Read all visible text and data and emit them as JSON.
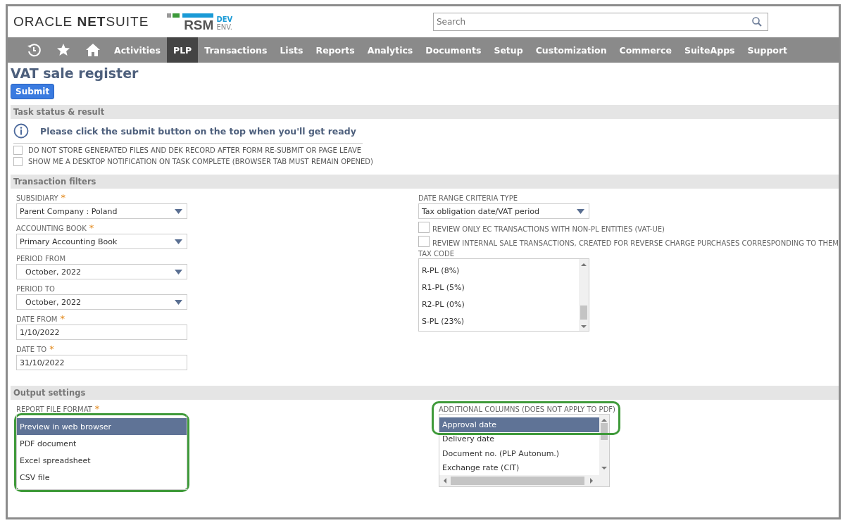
{
  "header": {
    "logo": "ORACLE **NET**SUITE",
    "rsm": "RSM",
    "env_top": "DEV",
    "env_bottom": "ENV.",
    "search": {
      "placeholder": "Search"
    }
  },
  "nav": {
    "icons": [
      {
        "kind": "recent"
      },
      {
        "kind": "favorites"
      },
      {
        "kind": "home"
      }
    ],
    "items": [
      {
        "label": "Activities",
        "selected": false
      },
      {
        "label": "PLP",
        "selected": true
      },
      {
        "label": "Transactions",
        "selected": false
      },
      {
        "label": "Lists",
        "selected": false
      },
      {
        "label": "Reports",
        "selected": false
      },
      {
        "label": "Analytics",
        "selected": false
      },
      {
        "label": "Documents",
        "selected": false
      },
      {
        "label": "Setup",
        "selected": false
      },
      {
        "label": "Customization",
        "selected": false
      },
      {
        "label": "Commerce",
        "selected": false
      },
      {
        "label": "SuiteApps",
        "selected": false
      },
      {
        "label": "Support",
        "selected": false
      }
    ]
  },
  "page_title": "VAT sale register",
  "submit_button": "Submit",
  "task_section": {
    "title": "Task status & result",
    "message": "Please click the submit button on the top when you'll get ready",
    "checkboxes": [
      {
        "label": "DO NOT STORE GENERATED FILES AND DEK RECORD AFTER FORM RE-SUBMIT OR PAGE LEAVE",
        "checked": false
      },
      {
        "label": "SHOW ME A DESKTOP NOTIFICATION ON TASK COMPLETE (BROWSER TAB MUST REMAIN OPENED)",
        "checked": false
      }
    ]
  },
  "filters_section": {
    "title": "Transaction filters",
    "left_fields": [
      {
        "kind": "select",
        "label": "SUBSIDIARY",
        "required_mark": "*",
        "value": "Parent Company : Poland",
        "indented": false
      },
      {
        "kind": "select",
        "label": "ACCOUNTING BOOK",
        "required_mark": "*",
        "value": "Primary Accounting Book",
        "indented": false
      },
      {
        "kind": "select",
        "label": "PERIOD FROM",
        "value": "October, 2022",
        "indented": true
      },
      {
        "kind": "select",
        "label": "PERIOD TO",
        "value": "October, 2022",
        "indented": true
      },
      {
        "kind": "text",
        "label": "DATE FROM",
        "required_mark": "*",
        "value": "1/10/2022"
      },
      {
        "kind": "text",
        "label": "DATE TO",
        "required_mark": "*",
        "value": "31/10/2022"
      }
    ],
    "date_range": {
      "label": "DATE RANGE CRITERIA TYPE",
      "value": "Tax obligation date/VAT period"
    },
    "checkboxes": [
      {
        "label": "REVIEW ONLY EC TRANSACTIONS WITH NON-PL ENTITIES (VAT-UE)",
        "checked": false
      },
      {
        "label": "REVIEW INTERNAL SALE TRANSACTIONS, CREATED FOR REVERSE CHARGE PURCHASES CORRESPONDING TO THEM",
        "checked": false
      }
    ],
    "tax_code": {
      "label": "TAX CODE",
      "items": [
        {
          "label": "R-PL (8%)",
          "selected": false
        },
        {
          "label": "R1-PL (5%)",
          "selected": false
        },
        {
          "label": "R2-PL (0%)",
          "selected": false
        },
        {
          "label": "S-PL (23%)",
          "selected": false
        }
      ]
    }
  },
  "output_section": {
    "title": "Output settings",
    "report_format": {
      "label": "REPORT FILE FORMAT",
      "required_mark": "*",
      "highlighted": true,
      "items": [
        {
          "label": "Preview in web browser",
          "selected": true
        },
        {
          "label": "PDF document",
          "selected": false
        },
        {
          "label": "Excel spreadsheet",
          "selected": false
        },
        {
          "label": "CSV file",
          "selected": false
        }
      ]
    },
    "additional_columns": {
      "label": "ADDITIONAL COLUMNS (DOES NOT APPLY TO PDF)",
      "highlighted": true,
      "items": [
        {
          "label": "Approval date",
          "selected": true
        },
        {
          "label": "Delivery date",
          "selected": false
        },
        {
          "label": "Document no. (PLP Autonum.)",
          "selected": false
        },
        {
          "label": "Exchange rate (CIT)",
          "selected": false
        }
      ]
    }
  }
}
